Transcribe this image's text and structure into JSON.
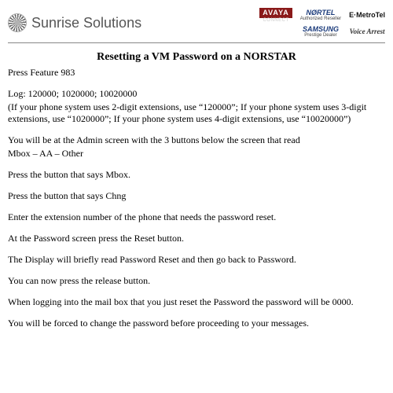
{
  "brand": "Sunrise Solutions",
  "partners": {
    "avaya_main": "AVAYA",
    "avaya_sub": "CONNECT",
    "nortel_main": "NØRTEL",
    "nortel_sub": "Authorized Reseller",
    "emetro_main": "E·MetroTel",
    "samsung_main": "SAMSUNG",
    "samsung_sub": "Prestige Dealer",
    "voice_main": "Voice Arrest"
  },
  "title": "Resetting a VM Password on a NORSTAR",
  "paragraphs": {
    "p1": "Press Feature 983",
    "p2a": "Log: 120000; 1020000; 10020000",
    "p2b": "(If your phone system uses 2-digit extensions, use “120000”; If your phone system uses 3-digit extensions, use “1020000”; If your phone system uses 4-digit extensions, use “10020000”)",
    "p3a": "You will be at the Admin screen with the 3 buttons below the screen that read",
    "p3b": "Mbox – AA – Other",
    "p4": "Press the button that says Mbox.",
    "p5": "Press the button that says Chng",
    "p6": "Enter the extension number of the phone that needs the password reset.",
    "p7": "At the Password screen press the Reset button.",
    "p8": "The Display will briefly read Password Reset and then go back to Password.",
    "p9": "You can now press the release button.",
    "p10": "When logging into the mail box that you just reset the Password the password will be 0000.",
    "p11": "You will be forced to change the password before proceeding to your messages."
  }
}
